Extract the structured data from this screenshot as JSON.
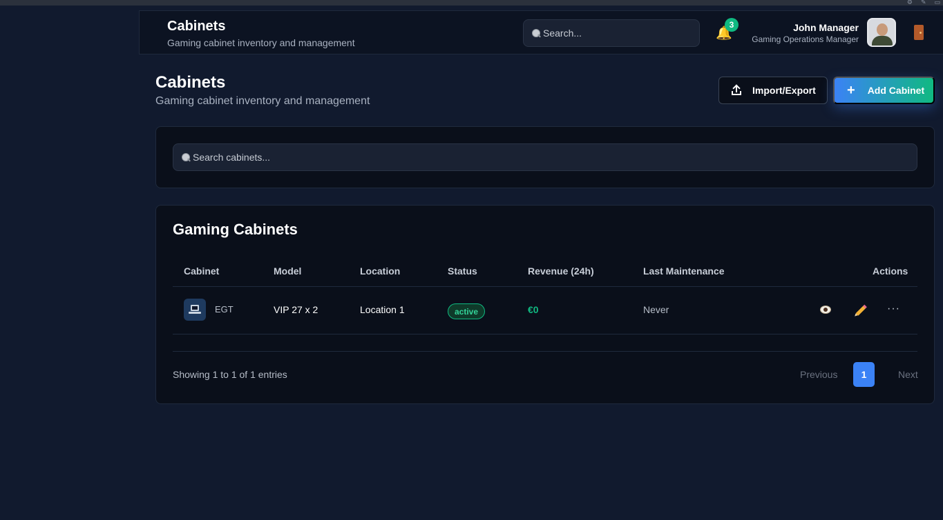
{
  "header": {
    "title": "Cabinets",
    "subtitle": "Gaming cabinet inventory and management",
    "search_placeholder": "Search...",
    "notification_count": "3",
    "user_name": "John Manager",
    "user_role": "Gaming Operations Manager",
    "icons": [
      "search-icon",
      "bell-icon",
      "avatar",
      "logout-door-icon"
    ]
  },
  "page": {
    "title": "Cabinets",
    "subtitle": "Gaming cabinet inventory and management",
    "import_export_label": "Import/Export",
    "add_cabinet_label": "Add Cabinet",
    "add_icon": "+"
  },
  "filters": {
    "search_placeholder": "Search cabinets..."
  },
  "table": {
    "title": "Gaming Cabinets",
    "columns": [
      "Cabinet",
      "Model",
      "Location",
      "Status",
      "Revenue (24h)",
      "Last Maintenance",
      "Actions"
    ],
    "rows": [
      {
        "cabinet": "EGT",
        "model": "VIP 27 x 2",
        "location": "Location 1",
        "status": "active",
        "revenue": "€0",
        "last_maintenance": "Never",
        "more_label": "···"
      }
    ]
  },
  "pagination": {
    "summary": "Showing 1 to 1 of 1 entries",
    "previous": "Previous",
    "current_page": "1",
    "next": "Next"
  },
  "colors": {
    "background": "#111a2e",
    "card": "#0a0f1a",
    "accent_blue": "#3b82f6",
    "accent_green": "#10b981"
  }
}
